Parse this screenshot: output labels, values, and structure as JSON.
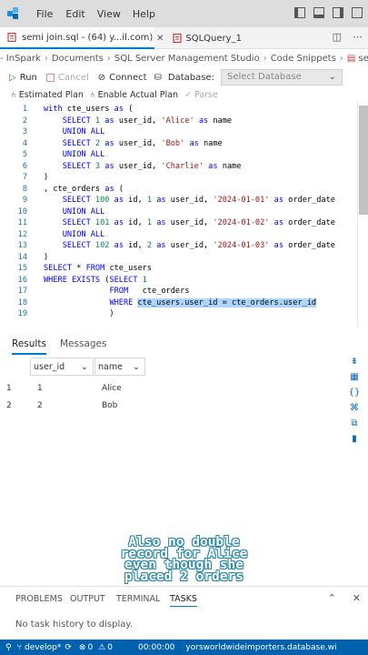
{
  "menu": [
    "File",
    "Edit",
    "View",
    "Help"
  ],
  "tabs": [
    {
      "label": "semi join.sql - (64) y...il.com)"
    },
    {
      "label": "SQLQuery_1"
    }
  ],
  "breadcrumb": [
    "- InSpark",
    "Documents",
    "SQL Server Management Studio",
    "Code Snippets",
    "semi join.sql"
  ],
  "toolbar": {
    "run": "Run",
    "cancel": "Cancel",
    "connect": "Connect",
    "database_label": "Database:",
    "database_value": "Select Database",
    "estimated_plan": "Estimated Plan",
    "actual_plan": "Enable Actual Plan",
    "parse": "Parse"
  },
  "code": [
    {
      "n": "1",
      "parts": [
        [
          "kw",
          "with "
        ],
        [
          "",
          "cte_users "
        ],
        [
          "kw",
          "as"
        ],
        [
          "",
          " ("
        ]
      ]
    },
    {
      "n": "2",
      "parts": [
        [
          "",
          "    "
        ],
        [
          "kw",
          "SELECT "
        ],
        [
          "num",
          "1"
        ],
        [
          "",
          " "
        ],
        [
          "kw",
          "as "
        ],
        [
          "",
          "user_id, "
        ],
        [
          "str",
          "'Alice'"
        ],
        [
          "",
          " "
        ],
        [
          "kw",
          "as "
        ],
        [
          "",
          "name"
        ]
      ]
    },
    {
      "n": "3",
      "parts": [
        [
          "",
          "    "
        ],
        [
          "kw",
          "UNION ALL"
        ]
      ]
    },
    {
      "n": "4",
      "parts": [
        [
          "",
          "    "
        ],
        [
          "kw",
          "SELECT "
        ],
        [
          "num",
          "2"
        ],
        [
          "",
          " "
        ],
        [
          "kw",
          "as "
        ],
        [
          "",
          "user_id, "
        ],
        [
          "str",
          "'Bob'"
        ],
        [
          "",
          " "
        ],
        [
          "kw",
          "as "
        ],
        [
          "",
          "name"
        ]
      ]
    },
    {
      "n": "5",
      "parts": [
        [
          "",
          "    "
        ],
        [
          "kw",
          "UNION ALL"
        ]
      ]
    },
    {
      "n": "6",
      "parts": [
        [
          "",
          "    "
        ],
        [
          "kw",
          "SELECT "
        ],
        [
          "num",
          "3"
        ],
        [
          "",
          " "
        ],
        [
          "kw",
          "as "
        ],
        [
          "",
          "user_id, "
        ],
        [
          "str",
          "'Charlie'"
        ],
        [
          "",
          " "
        ],
        [
          "kw",
          "as "
        ],
        [
          "",
          "name"
        ]
      ]
    },
    {
      "n": "7",
      "parts": [
        [
          "",
          ")"
        ]
      ]
    },
    {
      "n": "8",
      "parts": [
        [
          "",
          ", cte_orders "
        ],
        [
          "kw",
          "as"
        ],
        [
          "",
          " ("
        ]
      ]
    },
    {
      "n": "9",
      "parts": [
        [
          "",
          "    "
        ],
        [
          "kw",
          "SELECT "
        ],
        [
          "num",
          "100"
        ],
        [
          "",
          " "
        ],
        [
          "kw",
          "as "
        ],
        [
          "",
          "id, "
        ],
        [
          "num",
          "1"
        ],
        [
          "",
          " "
        ],
        [
          "kw",
          "as "
        ],
        [
          "",
          "user_id, "
        ],
        [
          "str",
          "'2024-01-01'"
        ],
        [
          "",
          " "
        ],
        [
          "kw",
          "as "
        ],
        [
          "",
          "order_date"
        ]
      ]
    },
    {
      "n": "10",
      "parts": [
        [
          "",
          "    "
        ],
        [
          "kw",
          "UNION ALL"
        ]
      ]
    },
    {
      "n": "11",
      "parts": [
        [
          "",
          "    "
        ],
        [
          "kw",
          "SELECT "
        ],
        [
          "num",
          "101"
        ],
        [
          "",
          " "
        ],
        [
          "kw",
          "as "
        ],
        [
          "",
          "id, "
        ],
        [
          "num",
          "1"
        ],
        [
          "",
          " "
        ],
        [
          "kw",
          "as "
        ],
        [
          "",
          "user_id, "
        ],
        [
          "str",
          "'2024-01-02'"
        ],
        [
          "",
          " "
        ],
        [
          "kw",
          "as "
        ],
        [
          "",
          "order_date"
        ]
      ]
    },
    {
      "n": "12",
      "parts": [
        [
          "",
          "    "
        ],
        [
          "kw",
          "UNION ALL"
        ]
      ]
    },
    {
      "n": "13",
      "parts": [
        [
          "",
          "    "
        ],
        [
          "kw",
          "SELECT "
        ],
        [
          "num",
          "102"
        ],
        [
          "",
          " "
        ],
        [
          "kw",
          "as "
        ],
        [
          "",
          "id, "
        ],
        [
          "num",
          "2"
        ],
        [
          "",
          " "
        ],
        [
          "kw",
          "as "
        ],
        [
          "",
          "user_id, "
        ],
        [
          "str",
          "'2024-01-03'"
        ],
        [
          "",
          " "
        ],
        [
          "kw",
          "as "
        ],
        [
          "",
          "order_date"
        ]
      ]
    },
    {
      "n": "14",
      "parts": [
        [
          "",
          ")"
        ]
      ]
    },
    {
      "n": "15",
      "parts": [
        [
          "kw",
          "SELECT "
        ],
        [
          "",
          "* "
        ],
        [
          "kw",
          "FROM "
        ],
        [
          "",
          "cte_users"
        ]
      ]
    },
    {
      "n": "16",
      "parts": [
        [
          "kw",
          "WHERE EXISTS "
        ],
        [
          "",
          "("
        ],
        [
          "kw",
          "SELECT "
        ],
        [
          "num",
          "1"
        ]
      ]
    },
    {
      "n": "17",
      "parts": [
        [
          "",
          "              "
        ],
        [
          "kw",
          "FROM "
        ],
        [
          "",
          "  cte_orders"
        ]
      ]
    },
    {
      "n": "18",
      "parts": [
        [
          "",
          "              "
        ],
        [
          "kw",
          "WHERE "
        ],
        [
          "sel",
          "cte_users.user_id = cte_orders.user_id"
        ]
      ]
    },
    {
      "n": "19",
      "parts": [
        [
          "",
          "              )"
        ]
      ]
    }
  ],
  "results": {
    "tabs": [
      "Results",
      "Messages"
    ],
    "columns": [
      "user_id",
      "name"
    ],
    "rows": [
      {
        "n": "1",
        "user_id": "1",
        "name": "Alice"
      },
      {
        "n": "2",
        "user_id": "2",
        "name": "Bob"
      }
    ]
  },
  "overlay_caption": [
    "Also no double",
    "record for Alice",
    "even though she",
    "placed 2 orders"
  ],
  "bottom_panel": {
    "tabs": [
      "PROBLEMS",
      "OUTPUT",
      "TERMINAL",
      "TASKS"
    ],
    "message": "No task history to display."
  },
  "status": {
    "branch": "develop*",
    "errors": "0",
    "warnings": "0",
    "time": "00:00:00",
    "server": "yorsworldwideimporters.database.wi"
  },
  "colors": {
    "accent": "#0078d4",
    "status_bar": "#0062ad",
    "keyword": "#0000ff",
    "string": "#a31515"
  }
}
